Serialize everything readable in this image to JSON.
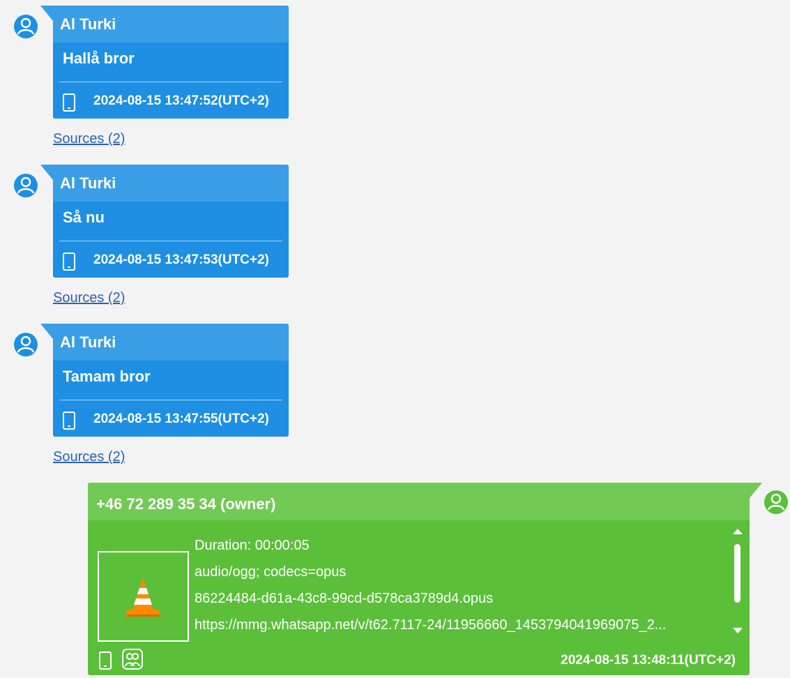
{
  "messages": [
    {
      "sender": "Al Turki",
      "text": "Hallå bror",
      "timestamp": "2024-08-15 13:47:52(UTC+2)",
      "sources": "Sources (2)"
    },
    {
      "sender": "Al Turki",
      "text": "Så nu",
      "timestamp": "2024-08-15 13:47:53(UTC+2)",
      "sources": "Sources (2)"
    },
    {
      "sender": "Al Turki",
      "text": "Tamam bror",
      "timestamp": "2024-08-15 13:47:55(UTC+2)",
      "sources": "Sources (2)"
    }
  ],
  "owner_message": {
    "sender": "+46 72 289 35 34 (owner)",
    "duration": "Duration: 00:00:05",
    "mime": "audio/ogg; codecs=opus",
    "filename": "86224484-d61a-43c8-99cd-d578ca3789d4.opus",
    "url": "https://mmg.whatsapp.net/v/t62.7117-24/11956660_1453794041969075_2...",
    "timestamp": "2024-08-15 13:48:11(UTC+2)"
  },
  "colors": {
    "incoming_bubble": "#1e8fe3",
    "incoming_header": "#3a9ee6",
    "outgoing_bubble": "#5bbf3a",
    "outgoing_header": "#72c954",
    "link": "#2b62ad"
  },
  "icons": {
    "incoming_avatar": "user-circle-icon",
    "outgoing_avatar": "user-circle-icon",
    "device": "phone-icon",
    "group": "group-icon",
    "media": "vlc-cone-icon"
  }
}
